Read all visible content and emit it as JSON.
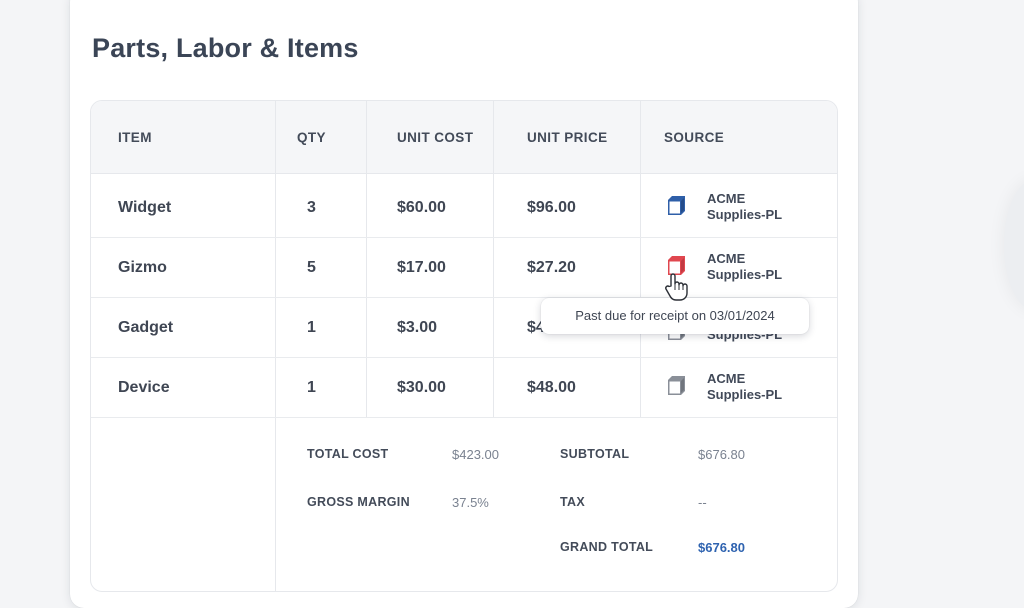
{
  "section": {
    "title": "Parts, Labor & Items"
  },
  "table": {
    "headers": [
      "ITEM",
      "QTY",
      "UNIT COST",
      "UNIT PRICE",
      "SOURCE"
    ],
    "rows": [
      {
        "item": "Widget",
        "qty": "3",
        "unit_cost": "$60.00",
        "unit_price": "$96.00",
        "source_line1": "ACME",
        "source_line2": "Supplies-PL",
        "source_icon": "box-icon",
        "status_color": "#2f5fa8"
      },
      {
        "item": "Gizmo",
        "qty": "5",
        "unit_cost": "$17.00",
        "unit_price": "$27.20",
        "source_line1": "ACME",
        "source_line2": "Supplies-PL",
        "source_icon": "box-icon",
        "status_color": "#e0474f"
      },
      {
        "item": "Gadget",
        "qty": "1",
        "unit_cost": "$3.00",
        "unit_price": "$4",
        "source_line1": "",
        "source_line2": "Supplies-PL",
        "source_icon": "box-icon",
        "status_color": "#8a8f98"
      },
      {
        "item": "Device",
        "qty": "1",
        "unit_cost": "$30.00",
        "unit_price": "$48.00",
        "source_line1": "ACME",
        "source_line2": "Supplies-PL",
        "source_icon": "box-icon",
        "status_color": "#8a8f98"
      }
    ]
  },
  "summary": {
    "total_cost_label": "TOTAL COST",
    "total_cost_value": "$423.00",
    "gross_margin_label": "GROSS MARGIN",
    "gross_margin_value": "37.5%",
    "subtotal_label": "SUBTOTAL",
    "subtotal_value": "$676.80",
    "tax_label": "TAX",
    "tax_value": "--",
    "grand_total_label": "GRAND TOTAL",
    "grand_total_value": "$676.80",
    "grand_total_color": "#2f63b0"
  },
  "tooltip": {
    "text": "Past due for receipt on 03/01/2024"
  },
  "cursor": {
    "icon": "hand-pointer-icon"
  }
}
